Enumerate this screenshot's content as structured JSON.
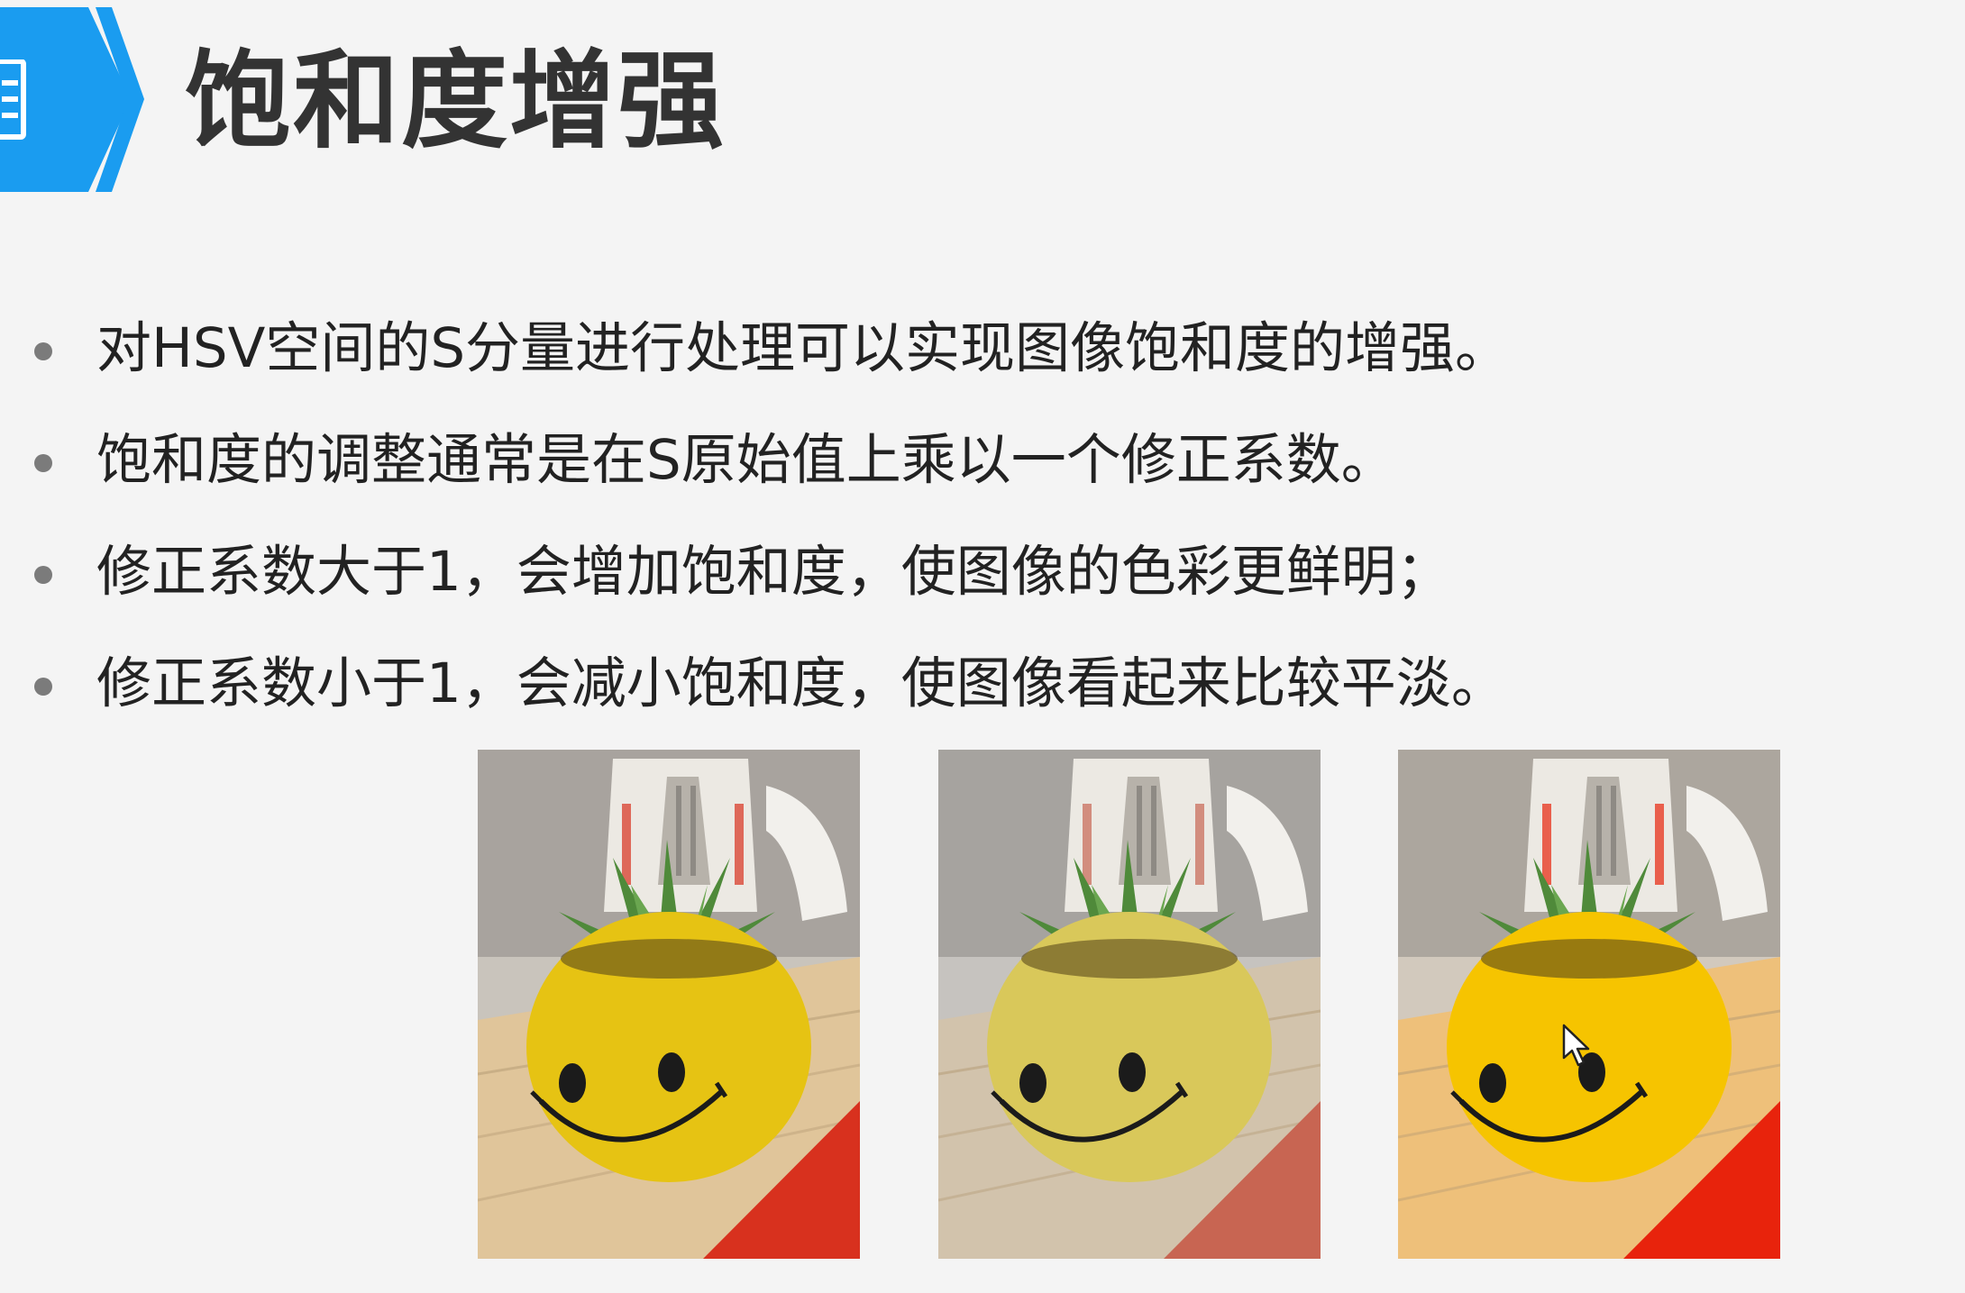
{
  "slide": {
    "title": "饱和度增强",
    "bullets": [
      "对HSV空间的S分量进行处理可以实现图像饱和度的增强。",
      "饱和度的调整通常是在S原始值上乘以一个修正系数。",
      "修正系数大于1，会增加饱和度，使图像的色彩更鲜明；",
      "修正系数小于1，会减小饱和度，使图像看起来比较平淡。"
    ]
  },
  "header_badge": {
    "icon": "document-icon",
    "color": "#1a9cf0"
  },
  "images": [
    {
      "name": "original",
      "pot_color": "#e6c313",
      "background": "#c9c4bc",
      "table_color": "#e0c59a",
      "red_color": "#d8311e"
    },
    {
      "name": "desaturated",
      "pot_color": "#d9c85a",
      "background": "#c6c3bf",
      "table_color": "#d2c3ac",
      "red_color": "#c86552"
    },
    {
      "name": "saturated",
      "pot_color": "#f6c400",
      "background": "#d2c9bd",
      "table_color": "#eec07a",
      "red_color": "#e8230c"
    }
  ],
  "cursor": {
    "icon": "mouse-pointer-icon"
  }
}
